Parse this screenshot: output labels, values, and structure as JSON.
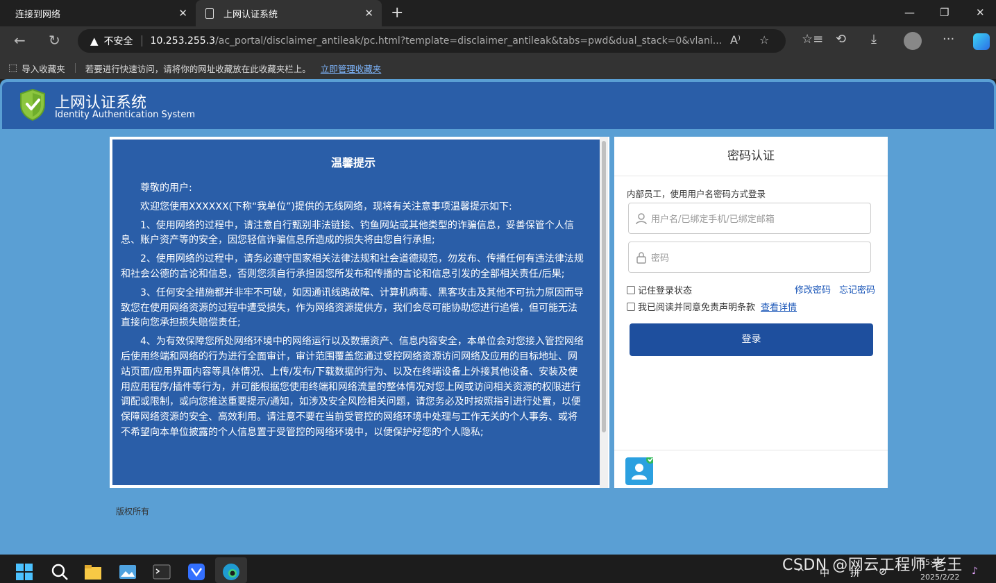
{
  "browser": {
    "tabs": [
      {
        "title": "连接到网络",
        "active": false
      },
      {
        "title": "上网认证系统",
        "active": true
      }
    ],
    "security_label": "不安全",
    "url_host": "10.253.255.3",
    "url_path": "/ac_portal/disclaimer_antileak/pc.html?template=disclaimer_antileak&tabs=pwd&dual_stack=0&vlani...",
    "favorites_bar": {
      "import_label": "导入收藏夹",
      "hint": "若要进行快速访问，请将你的网址收藏放在此收藏夹栏上。",
      "manage_link": "立即管理收藏夹"
    }
  },
  "header": {
    "title": "上网认证系统",
    "subtitle": "Identity Authentication System"
  },
  "notice": {
    "title": "温馨提示",
    "paragraphs": [
      "尊敬的用户:",
      "欢迎您使用XXXXXX(下称“我单位”)提供的无线网络，现将有关注意事项温馨提示如下:",
      "1、使用网络的过程中，请注意自行甄别非法链接、钓鱼网站或其他类型的诈骗信息，妥善保管个人信息、账户资产等的安全，因您轻信诈骗信息所造成的损失将由您自行承担;",
      "2、使用网络的过程中，请务必遵守国家相关法律法规和社会道德规范，勿发布、传播任何有违法律法规和社会公德的言论和信息，否则您须自行承担因您所发布和传播的言论和信息引发的全部相关责任/后果;",
      "3、任何安全措施都并非牢不可破，如因通讯线路故障、计算机病毒、黑客攻击及其他不可抗力原因而导致您在使用网络资源的过程中遭受损失，作为网络资源提供方，我们会尽可能协助您进行追偿，但可能无法直接向您承担损失赔偿责任;",
      "4、为有效保障您所处网络环境中的网络运行以及数据资产、信息内容安全，本单位会对您接入管控网络后使用终端和网络的行为进行全面审计，审计范围覆盖您通过受控网络资源访问网络及应用的目标地址、网站页面/应用界面内容等具体情况、上传/发布/下载数据的行为、以及在终端设备上外接其他设备、安装及使用应用程序/插件等行为，并可能根据您使用终端和网络流量的整体情况对您上网或访问相关资源的权限进行调配或限制，或向您推送重要提示/通知，如涉及安全风险相关问题，请您务必及时按照指引进行处置，以便保障网络资源的安全、高效利用。请注意不要在当前受管控的网络环境中处理与工作无关的个人事务、或将不希望向本单位披露的个人信息置于受管控的网络环境中，以便保护好您的个人隐私;"
    ]
  },
  "login": {
    "title": "密码认证",
    "hint": "内部员工，使用用户名密码方式登录",
    "username_placeholder": "用户名/已绑定手机/已绑定邮箱",
    "password_placeholder": "密码",
    "remember_label": "记住登录状态",
    "change_password": "修改密码",
    "forgot_password": "忘记密码",
    "agree_label": "我已阅读并同意免责声明条款",
    "view_details": "查看详情",
    "submit_label": "登录"
  },
  "footer": {
    "copyright": "版权所有"
  },
  "taskbar": {
    "tray_ime": "中",
    "tray_pin": "拼",
    "time": "15:46",
    "date": "2025/2/22"
  },
  "watermark": "CSDN @网云工程师 老王"
}
